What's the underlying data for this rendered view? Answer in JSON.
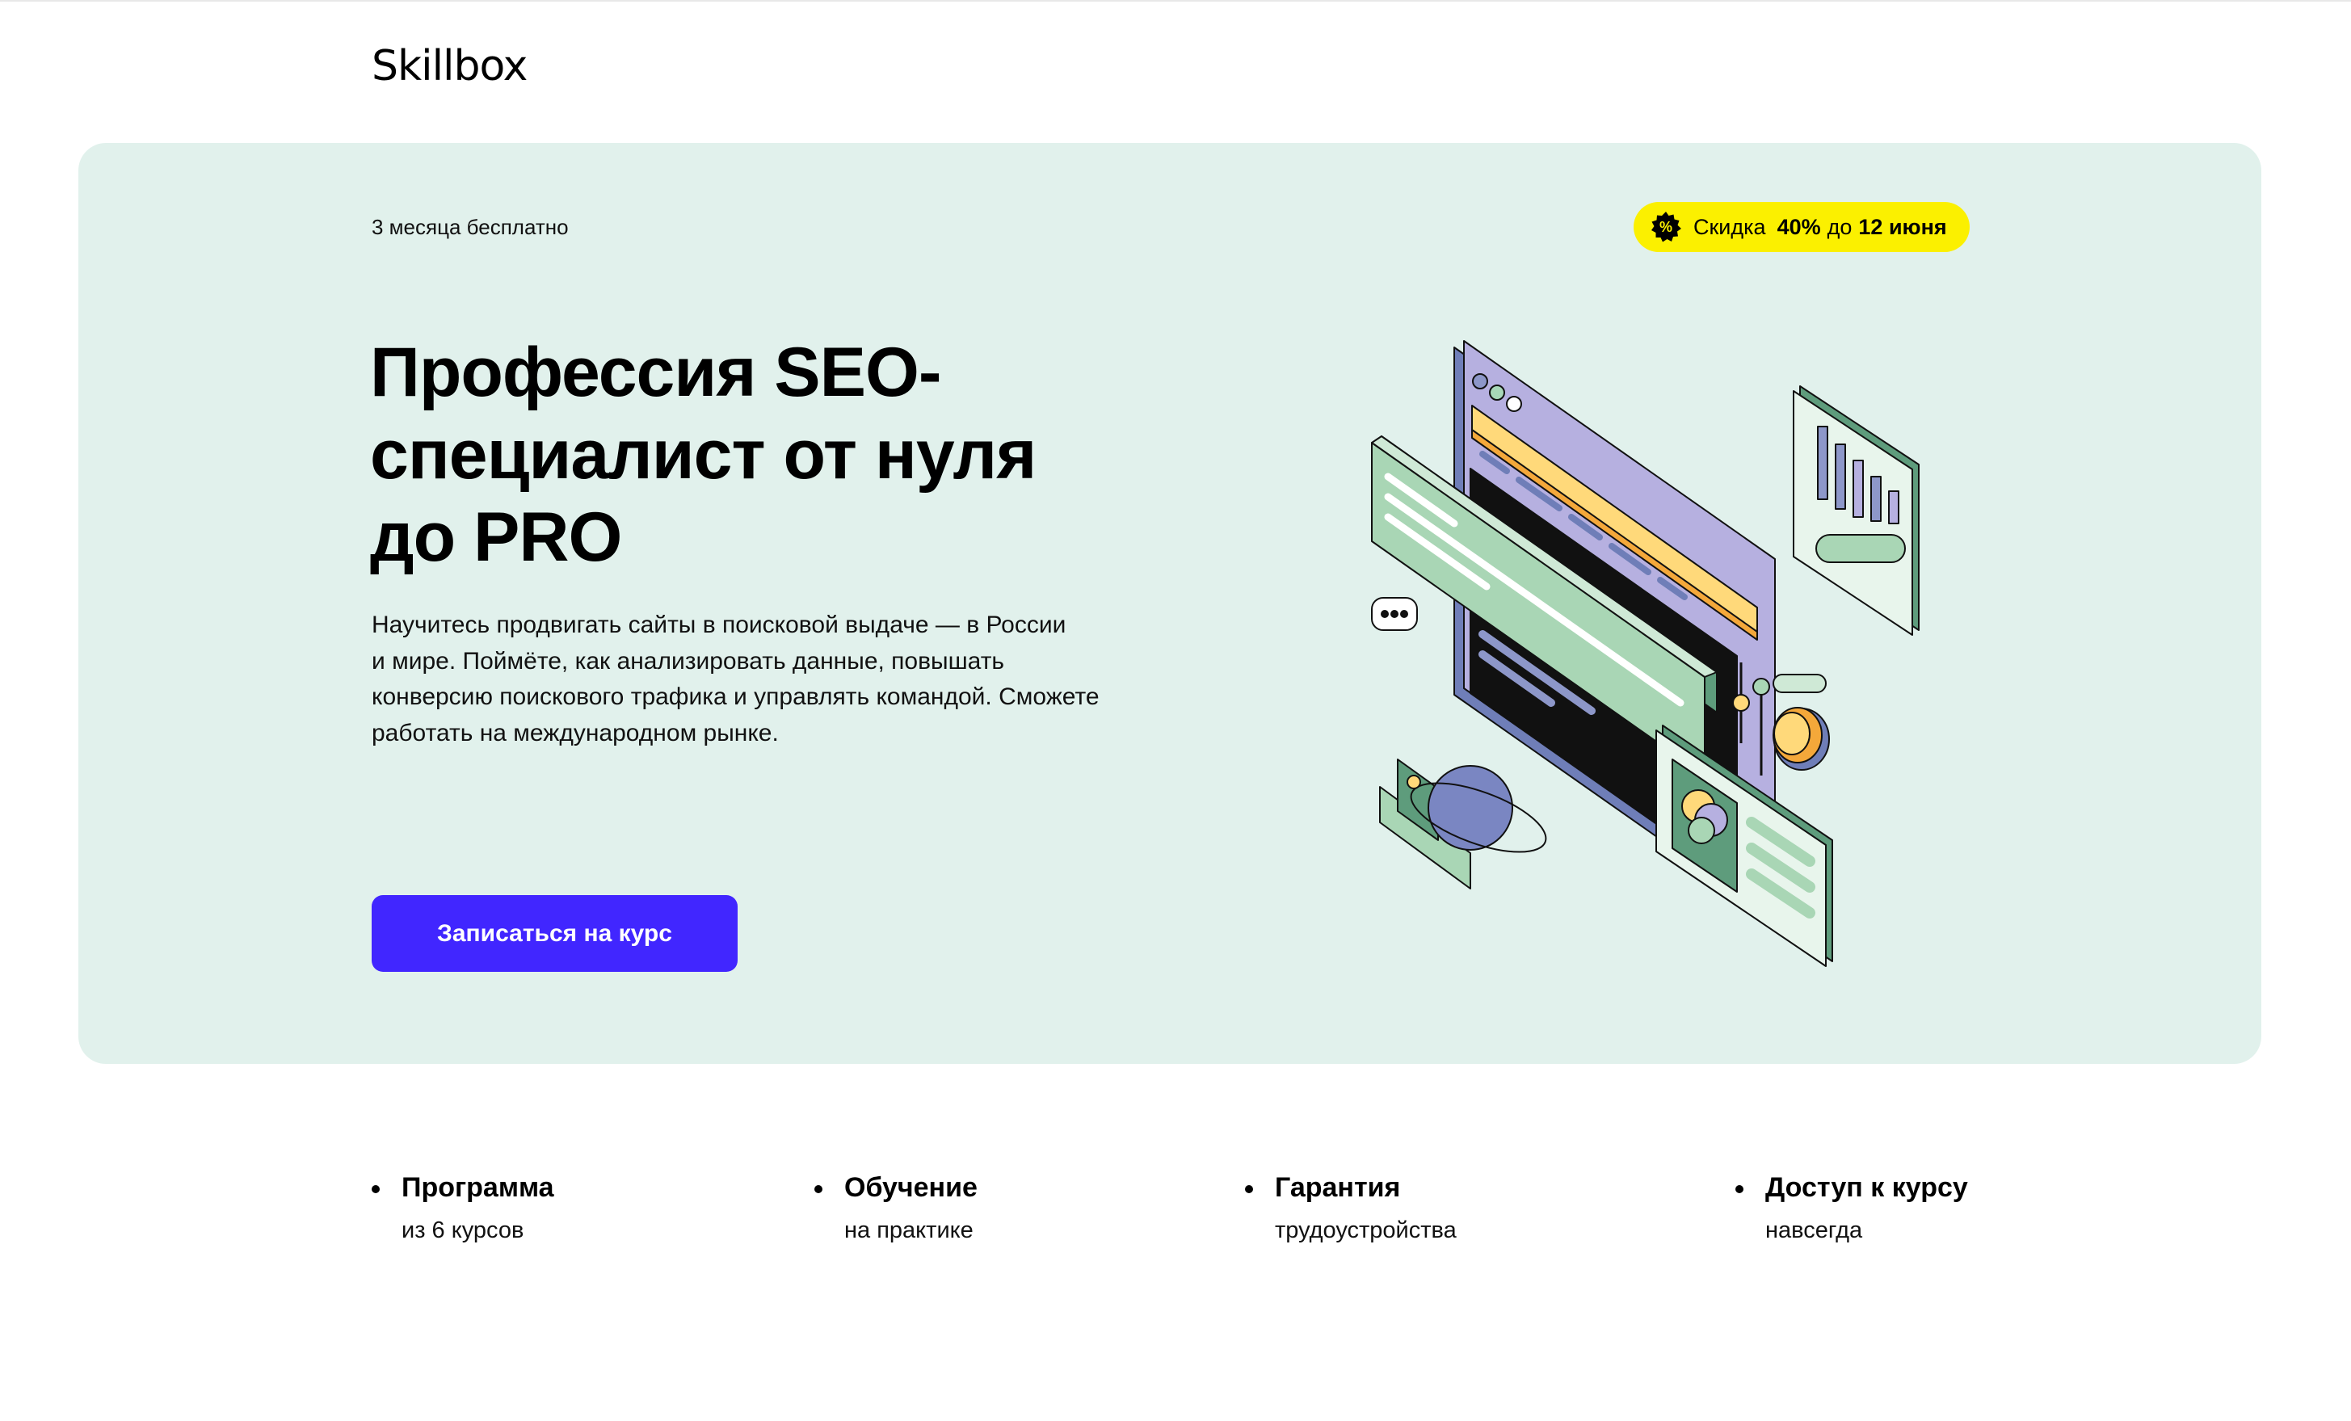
{
  "header": {
    "logo_text": "Skillbox"
  },
  "hero": {
    "eyebrow": "3 месяца бесплатно",
    "promo": {
      "icon": "percent-icon",
      "prefix": "Скидка",
      "discount": "40%",
      "middle": "до",
      "date": "12 июня"
    },
    "title_lines": [
      "Профессия SEO-",
      "специалист от нуля",
      "до PRO"
    ],
    "description_lines": [
      "Научитесь продвигать сайты в поисковой выдаче — в России",
      "и мире. Поймёте, как анализировать данные, повышать",
      "конверсию поискового трафика и управлять командой. Сможете",
      "работать на международном рынке."
    ],
    "cta_label": "Записаться на курс",
    "colors": {
      "background": "#e1f1ec",
      "cta": "#4126ff",
      "promo": "#fbf000"
    }
  },
  "features": [
    {
      "title": "Программа",
      "subtitle": "из 6 курсов"
    },
    {
      "title": "Обучение",
      "subtitle": "на практике"
    },
    {
      "title": "Гарантия",
      "subtitle": "трудоустройства"
    },
    {
      "title": "Доступ к курсу",
      "subtitle": "навсегда"
    }
  ]
}
